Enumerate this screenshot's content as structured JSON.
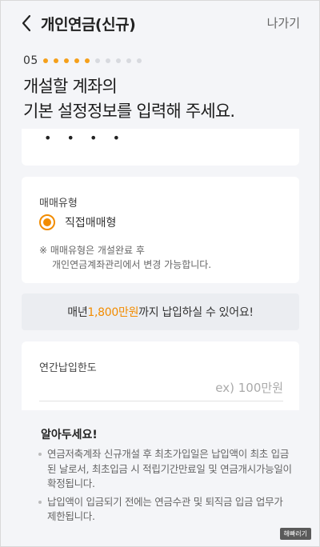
{
  "header": {
    "title": "개인연금(신규)",
    "exit_label": "나가기"
  },
  "progress": {
    "step": "05",
    "completed": 5,
    "total": 10
  },
  "headline": {
    "line1": "개설할 계좌의",
    "line2": "기본 설정정보를 입력해 주세요."
  },
  "password_field": {
    "masked_value": "• • • •"
  },
  "trade_type": {
    "label": "매매유형",
    "option": "직접매매형",
    "selected": true,
    "notice_line1": "※ 매매유형은 개설완료 후",
    "notice_line2": "개인연금계좌관리에서 변경 가능합니다."
  },
  "limit_notice": {
    "prefix": "매년 ",
    "amount": "1,800만원",
    "suffix": "까지 납입하실 수 있어요!"
  },
  "annual_limit": {
    "label": "연간납입한도",
    "value": "",
    "placeholder": "ex) 100만원"
  },
  "info": {
    "title": "알아두세요!",
    "items": [
      "연금저축계좌 신규개설 후 최초가입일은 납입액이 최초 입금된 날로서, 최초입금 시 적립기간만료일 및 연금개시가능일이 확정됩니다.",
      "납입액이 입금되기 전에는 연금수관 및 퇴직금 입금 업무가 제한됩니다."
    ]
  },
  "watermark": "해빠러기",
  "colors": {
    "accent": "#f28c00",
    "dot_active": "#f5a01a",
    "dot_inactive": "#d8dadf",
    "background": "#f4f5f8"
  }
}
